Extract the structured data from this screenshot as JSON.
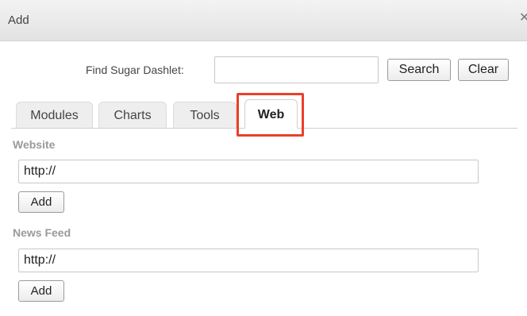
{
  "dialog": {
    "title": "Add",
    "close_icon": "close-icon"
  },
  "search": {
    "label": "Find Sugar Dashlet:",
    "value": "",
    "placeholder": "",
    "search_label": "Search",
    "clear_label": "Clear"
  },
  "tabs": [
    {
      "label": "Modules",
      "active": false
    },
    {
      "label": "Charts",
      "active": false
    },
    {
      "label": "Tools",
      "active": false
    },
    {
      "label": "Web",
      "active": true
    }
  ],
  "web": {
    "website": {
      "label": "Website",
      "value": "http://",
      "add_label": "Add"
    },
    "news_feed": {
      "label": "News Feed",
      "value": "http://",
      "add_label": "Add"
    }
  },
  "colors": {
    "highlight": "#e8412a",
    "section_label": "#9a9a9a",
    "titlebar": "#e8e8e8"
  }
}
